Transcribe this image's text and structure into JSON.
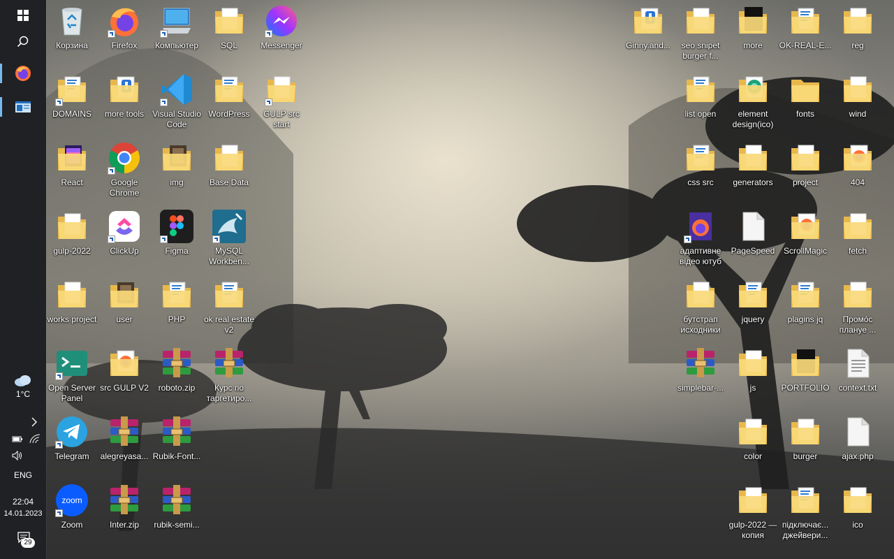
{
  "taskbar": {
    "pinned": [
      {
        "name": "start",
        "icon": "windows-icon"
      },
      {
        "name": "search",
        "icon": "search-icon"
      },
      {
        "name": "firefox",
        "icon": "firefox-icon",
        "active": true
      },
      {
        "name": "window",
        "icon": "window-icon",
        "active": true
      }
    ],
    "weather": {
      "temp": "1°C",
      "icon": "cloud-icon"
    },
    "language": "ENG",
    "time": "22:04",
    "date": "14.01.2023",
    "notifications": "29"
  },
  "desktop": {
    "left": [
      {
        "label": "Корзина",
        "type": "recycle",
        "shortcut": false
      },
      {
        "label": "Firefox",
        "type": "firefox",
        "shortcut": true
      },
      {
        "label": "Компьютер",
        "type": "computer",
        "shortcut": true
      },
      {
        "label": "SQL",
        "type": "folder",
        "shortcut": false
      },
      {
        "label": "Messenger",
        "type": "messenger",
        "shortcut": true
      },
      {
        "label": "DOMAINS",
        "type": "folder-docs",
        "shortcut": true
      },
      {
        "label": "more tools",
        "type": "folder-blue",
        "shortcut": false
      },
      {
        "label": "Visual Studio Code",
        "type": "vscode",
        "shortcut": true
      },
      {
        "label": "WordPress",
        "type": "folder-docs",
        "shortcut": false
      },
      {
        "label": "GULP src start",
        "type": "folder",
        "shortcut": true
      },
      {
        "label": "React",
        "type": "folder-purple",
        "shortcut": false
      },
      {
        "label": "Google Chrome",
        "type": "chrome",
        "shortcut": true
      },
      {
        "label": "img",
        "type": "folder-dark",
        "shortcut": false
      },
      {
        "label": "Base Data",
        "type": "folder",
        "shortcut": false
      },
      {
        "label": "gulp-2022",
        "type": "folder",
        "shortcut": false
      },
      {
        "label": "ClickUp",
        "type": "clickup",
        "shortcut": true
      },
      {
        "label": "Figma",
        "type": "figma",
        "shortcut": true
      },
      {
        "label": "MySQL Workben...",
        "type": "mysql",
        "shortcut": true
      },
      {
        "label": "works project",
        "type": "folder",
        "shortcut": false
      },
      {
        "label": "user",
        "type": "folder-dark",
        "shortcut": false
      },
      {
        "label": "PHP",
        "type": "folder-docs",
        "shortcut": false
      },
      {
        "label": "ok real estate v2",
        "type": "folder-docs",
        "shortcut": false
      },
      {
        "label": "Open Server Panel",
        "type": "openserver",
        "shortcut": true
      },
      {
        "label": "src GULP V2",
        "type": "folder-firefox",
        "shortcut": false
      },
      {
        "label": "roboto.zip",
        "type": "winrar",
        "shortcut": false
      },
      {
        "label": "Курс по таргетиро...",
        "type": "winrar",
        "shortcut": false
      },
      {
        "label": "Telegram",
        "type": "telegram",
        "shortcut": true
      },
      {
        "label": "alegreyasa...",
        "type": "winrar",
        "shortcut": false
      },
      {
        "label": "Rubik-Font...",
        "type": "winrar",
        "shortcut": false
      },
      {
        "label": "Zoom",
        "type": "zoom",
        "shortcut": true
      },
      {
        "label": "Inter.zip",
        "type": "winrar",
        "shortcut": false
      },
      {
        "label": "rubik-semi...",
        "type": "winrar",
        "shortcut": false
      }
    ],
    "right": [
      {
        "label": "Ginny.and...",
        "type": "folder-blue",
        "shortcut": false
      },
      {
        "label": "seo snipet burger f...",
        "type": "folder",
        "shortcut": false
      },
      {
        "label": "more",
        "type": "folder-black",
        "shortcut": false
      },
      {
        "label": "OK-REAL-E...",
        "type": "folder-docs",
        "shortcut": false
      },
      {
        "label": "reg",
        "type": "folder",
        "shortcut": false
      },
      {
        "label": "list open",
        "type": "folder-docs",
        "shortcut": false
      },
      {
        "label": "element design(ico)",
        "type": "folder-green",
        "shortcut": false
      },
      {
        "label": "fonts",
        "type": "folder-plain",
        "shortcut": false
      },
      {
        "label": "wind",
        "type": "folder",
        "shortcut": false
      },
      {
        "label": "css src",
        "type": "folder-docs",
        "shortcut": false
      },
      {
        "label": "generators",
        "type": "folder",
        "shortcut": false
      },
      {
        "label": "project",
        "type": "folder",
        "shortcut": false
      },
      {
        "label": "404",
        "type": "folder-firefox",
        "shortcut": false
      },
      {
        "label": "адаптивне відео ютуб",
        "type": "firefox-doc",
        "shortcut": true
      },
      {
        "label": "PageSpeed",
        "type": "file",
        "shortcut": false
      },
      {
        "label": "ScrollMagic",
        "type": "folder-firefox",
        "shortcut": false
      },
      {
        "label": "fetch",
        "type": "folder",
        "shortcut": false
      },
      {
        "label": "бутстрап исходники",
        "type": "folder",
        "shortcut": false
      },
      {
        "label": "jquery",
        "type": "folder-docs",
        "shortcut": false
      },
      {
        "label": "plagins jq",
        "type": "folder-docs",
        "shortcut": false
      },
      {
        "label": "Промо́с плануе ...",
        "type": "folder",
        "shortcut": false
      },
      {
        "label": "simplebar-...",
        "type": "winrar",
        "shortcut": false
      },
      {
        "label": "js",
        "type": "folder",
        "shortcut": false
      },
      {
        "label": "PORTFOLIO",
        "type": "folder-black",
        "shortcut": false
      },
      {
        "label": "context.txt",
        "type": "txt",
        "shortcut": false
      },
      {
        "label": "color",
        "type": "folder",
        "shortcut": false
      },
      {
        "label": "burger",
        "type": "folder",
        "shortcut": false
      },
      {
        "label": "ajax.php",
        "type": "file",
        "shortcut": false
      },
      {
        "label": "gulp-2022 — копия",
        "type": "folder",
        "shortcut": false
      },
      {
        "label": "підключає... джейвери...",
        "type": "folder-docs",
        "shortcut": false
      },
      {
        "label": "ico",
        "type": "folder",
        "shortcut": false
      }
    ]
  }
}
